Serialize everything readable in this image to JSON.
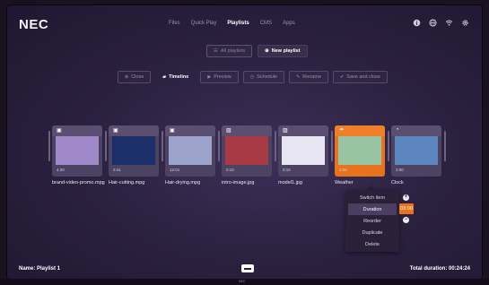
{
  "brand": "NEC",
  "brand_bottom": "NEC",
  "nav": {
    "tabs": [
      {
        "label": "Files"
      },
      {
        "label": "Quick Play"
      },
      {
        "label": "Playlists"
      },
      {
        "label": "CMS"
      },
      {
        "label": "Apps"
      }
    ],
    "active": "Playlists"
  },
  "playlist_switch": {
    "all_label": "All playlists",
    "new_label": "New playlist"
  },
  "toolbar": {
    "close": "Close",
    "timeline": "Timeline",
    "preview": "Preview",
    "schedule": "Schedule",
    "rename": "Rename",
    "save_close": "Save and close"
  },
  "items": [
    {
      "name": "brand-video-promo.mpg",
      "duration": "4:20",
      "color": "#9f89c9",
      "icon": "video-icon"
    },
    {
      "name": "Hair-cutting.mpg",
      "duration": "3:41",
      "color": "#1c2f68",
      "icon": "video-icon"
    },
    {
      "name": "Hair-drying.mpg",
      "duration": "12:01",
      "color": "#9ca4cc",
      "icon": "video-icon"
    },
    {
      "name": "intro-image.jpg",
      "duration": "0:10",
      "color": "#a73a44",
      "icon": "image-icon"
    },
    {
      "name": "model1.jpg",
      "duration": "0:10",
      "color": "#e7e5f1",
      "icon": "image-icon"
    },
    {
      "name": "Weather",
      "duration": "3:00",
      "color": "#98c4a3",
      "icon": "weather-icon"
    },
    {
      "name": "Clock",
      "duration": "2:00",
      "color": "#5d86bf",
      "icon": "clock-icon"
    }
  ],
  "context_menu": {
    "items": [
      "Switch item",
      "Duration",
      "Reorder",
      "Duplicate",
      "Delete"
    ],
    "highlighted": "Duration",
    "duration_value": "03:00"
  },
  "footer": {
    "name_label": "Name: Playlist 1",
    "total_label": "Total duration: 00:24:24"
  },
  "colors": {
    "accent": "#e8731c",
    "background": "#2c2241"
  }
}
